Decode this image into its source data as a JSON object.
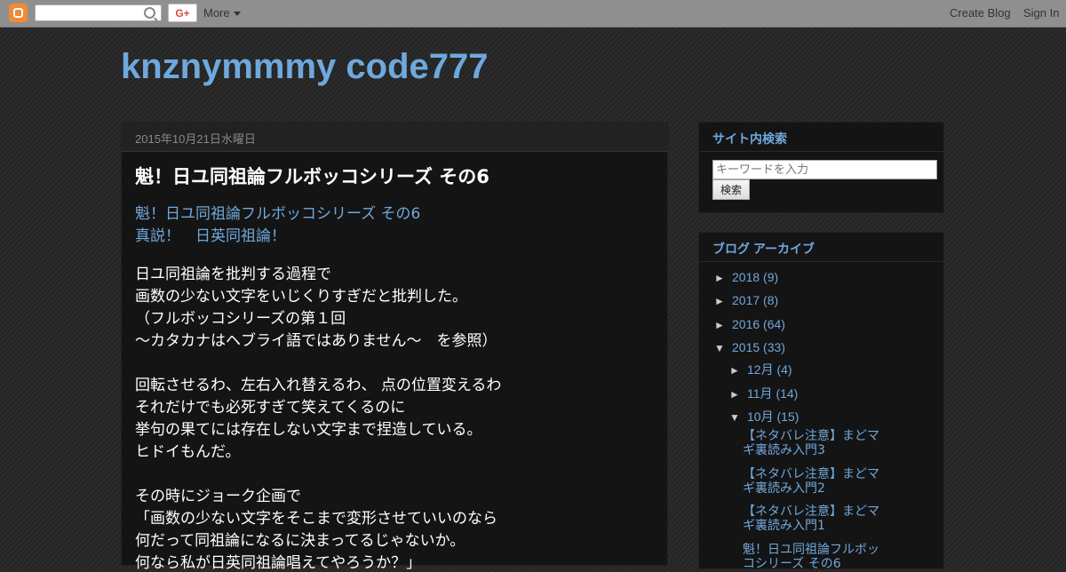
{
  "navbar": {
    "more_label": "More",
    "gplus_label": "G+",
    "create_blog": "Create Blog",
    "sign_in": "Sign In"
  },
  "blog": {
    "title": "knznymmmy code777"
  },
  "post": {
    "date": "2015年10月21日水曜日",
    "title": "魁！日ユ同祖論フルボッコシリーズ その6",
    "link1": "魁！日ユ同祖論フルボッコシリーズ その6",
    "link2": "真説！　日英同祖論！",
    "lines": [
      "日ユ同祖論を批判する過程で",
      "画数の少ない文字をいじくりすぎだと批判した。",
      "（フルボッコシリーズの第１回",
      "〜カタカナはヘブライ語ではありません〜　を参照）",
      "回転させるわ、左右入れ替えるわ、 点の位置変えるわ",
      "それだけでも必死すぎて笑えてくるのに",
      "挙句の果てには存在しない文字まで捏造している。",
      "ヒドイもんだ。",
      "その時にジョーク企画で",
      "「画数の少ない文字をそこまで変形させていいのなら",
      "何だって同祖論になるに決まってるじゃないか。",
      "何なら私が日英同祖論唱えてやろうか？」"
    ]
  },
  "search_widget": {
    "title": "サイト内検索",
    "placeholder": "キーワードを入力",
    "button": "検索"
  },
  "archive": {
    "title": "ブログ アーカイブ",
    "years": [
      {
        "label": "2018",
        "count": "(9)",
        "arrow": "►"
      },
      {
        "label": "2017",
        "count": "(8)",
        "arrow": "►"
      },
      {
        "label": "2016",
        "count": "(64)",
        "arrow": "►"
      },
      {
        "label": "2015",
        "count": "(33)",
        "arrow": "▼"
      }
    ],
    "months": [
      {
        "label": "12月",
        "count": "(4)",
        "arrow": "►"
      },
      {
        "label": "11月",
        "count": "(14)",
        "arrow": "►"
      },
      {
        "label": "10月",
        "count": "(15)",
        "arrow": "▼"
      }
    ],
    "posts": [
      "【ネタバレ注意】まどマギ裏読み入門3",
      "【ネタバレ注意】まどマギ裏読み入門2",
      "【ネタバレ注意】まどマギ裏読み入門1",
      "魁！日ユ同祖論フルボッコシリーズ その6"
    ]
  }
}
